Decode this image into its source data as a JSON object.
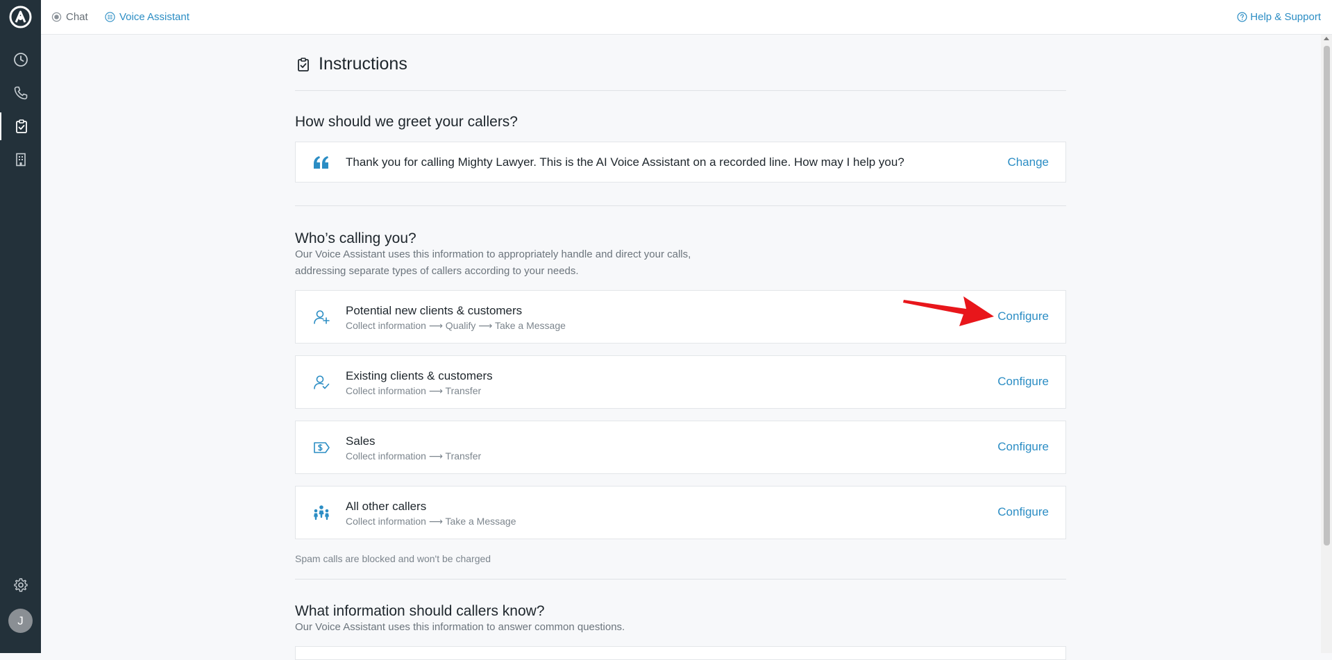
{
  "nav": {
    "tabs": [
      {
        "label": "Chat",
        "icon": "chat-dot-icon"
      },
      {
        "label": "Voice Assistant",
        "icon": "grid-dial-icon"
      }
    ],
    "help_label": "Help & Support"
  },
  "sidebar": {
    "items": [
      {
        "icon": "clock-icon",
        "name": "history"
      },
      {
        "icon": "phone-icon",
        "name": "calls"
      },
      {
        "icon": "clipboard-check-icon",
        "name": "instructions",
        "active": true
      },
      {
        "icon": "building-icon",
        "name": "business"
      }
    ],
    "settings_icon": "gear-icon",
    "avatar_initial": "J"
  },
  "page": {
    "title": "Instructions"
  },
  "greeting": {
    "heading": "How should we greet your callers?",
    "text": "Thank you for calling Mighty Lawyer. This is the AI Voice Assistant on a recorded line. How may I help you?",
    "action": "Change"
  },
  "callers": {
    "heading": "Who’s calling you?",
    "desc_line1": "Our Voice Assistant uses this information to appropriately handle and direct your calls,",
    "desc_line2": "addressing separate types of callers according to your needs.",
    "items": [
      {
        "name": "Potential new clients & customers",
        "flow": "Collect information ⟶ Qualify ⟶ Take a Message",
        "action": "Configure",
        "icon": "user-plus-icon"
      },
      {
        "name": "Existing clients & customers",
        "flow": "Collect information ⟶ Transfer",
        "action": "Configure",
        "icon": "user-check-icon"
      },
      {
        "name": "Sales",
        "flow": "Collect information ⟶ Transfer",
        "action": "Configure",
        "icon": "price-tag-icon"
      },
      {
        "name": "All other callers",
        "flow": "Collect information ⟶ Take a Message",
        "action": "Configure",
        "icon": "people-group-icon"
      }
    ],
    "footnote": "Spam calls are blocked and won't be charged"
  },
  "info": {
    "heading": "What information should callers know?",
    "desc": "Our Voice Assistant uses this information to answer common questions."
  },
  "colors": {
    "accent": "#2b8dc4",
    "sidebar": "#23313a",
    "annotation_arrow": "#e8161b"
  }
}
